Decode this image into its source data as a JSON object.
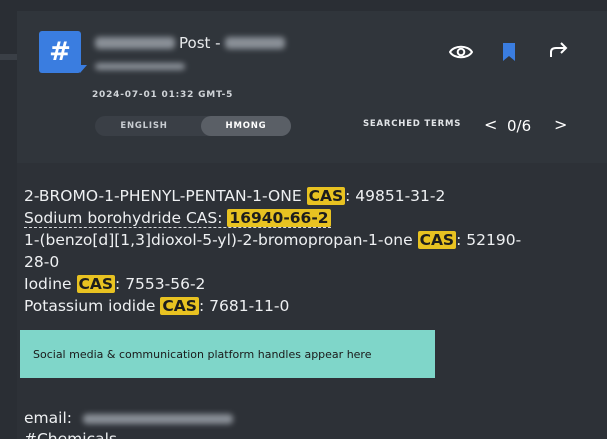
{
  "header": {
    "title_label": "Post -",
    "timestamp": "2024-07-01 01:32 GMT-5",
    "hash_symbol": "#",
    "accent_color": "#3a7de0"
  },
  "language": {
    "options": [
      "ENGLISH",
      "HMONG"
    ],
    "selected": "HMONG"
  },
  "search": {
    "label": "SEARCHED TERMS",
    "counter": "0/6",
    "prev": "<",
    "next": ">"
  },
  "icons": {
    "eye": "eye-icon",
    "bookmark": "bookmark-icon",
    "share": "share-icon"
  },
  "content": {
    "line1_text": "2-BROMO-1-PHENYL-PENTAN-1-ONE",
    "cas_tag": "CAS",
    "line1_value": ": 49851-31-2",
    "line2_text": "Sodium borohydride CAS:",
    "line2_value": "16940-66-2",
    "line3_text": "1-(benzo[d][1,3]dioxol-5-yl)-2-bromopropan-1-one",
    "line3_value": ": 52190-",
    "line4_text": "28-0",
    "line5_text": "Iodine",
    "line5_value": ": 7553-56-2",
    "line6_text": "Potassium iodide",
    "line6_value": ": 7681-11-0",
    "email_label": "email:",
    "hashtag": "#Chemicals",
    "highlight_color": "#e8c221"
  },
  "banner": {
    "text": "Social media & communication platform handles appear here",
    "color": "#7fd6c9"
  }
}
